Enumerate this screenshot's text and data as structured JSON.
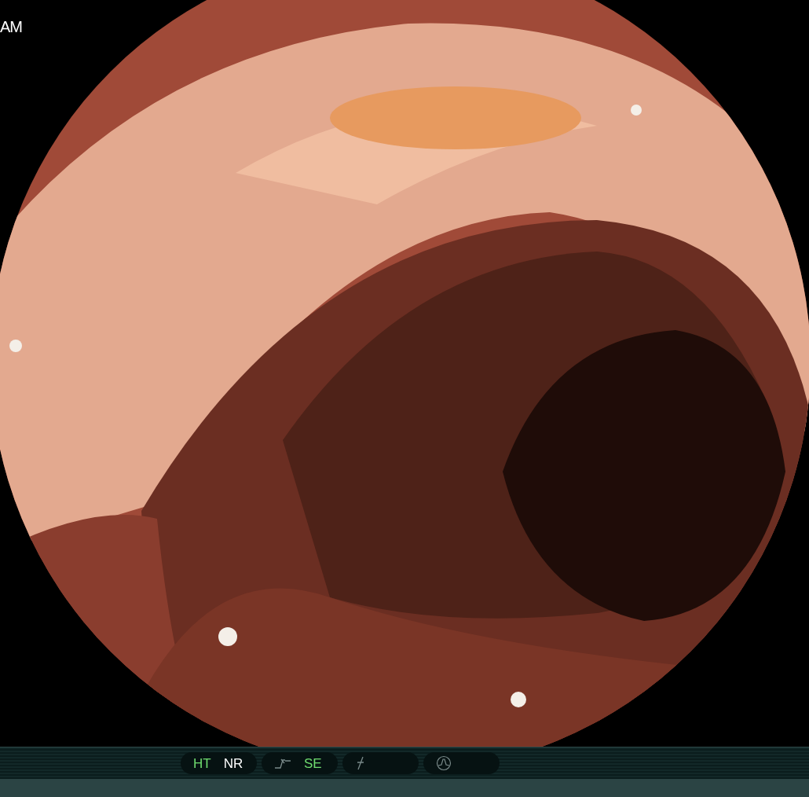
{
  "clock": "AM",
  "status_bar": {
    "groups": [
      {
        "items": [
          {
            "kind": "text",
            "label": "HT",
            "on": true
          },
          {
            "kind": "text",
            "label": "NR",
            "on": false
          }
        ]
      },
      {
        "items": [
          {
            "kind": "enhance"
          },
          {
            "kind": "text",
            "label": "SE",
            "on": true
          }
        ]
      },
      {
        "items": [
          {
            "kind": "slash"
          }
        ]
      },
      {
        "items": [
          {
            "kind": "peak"
          }
        ]
      }
    ]
  }
}
